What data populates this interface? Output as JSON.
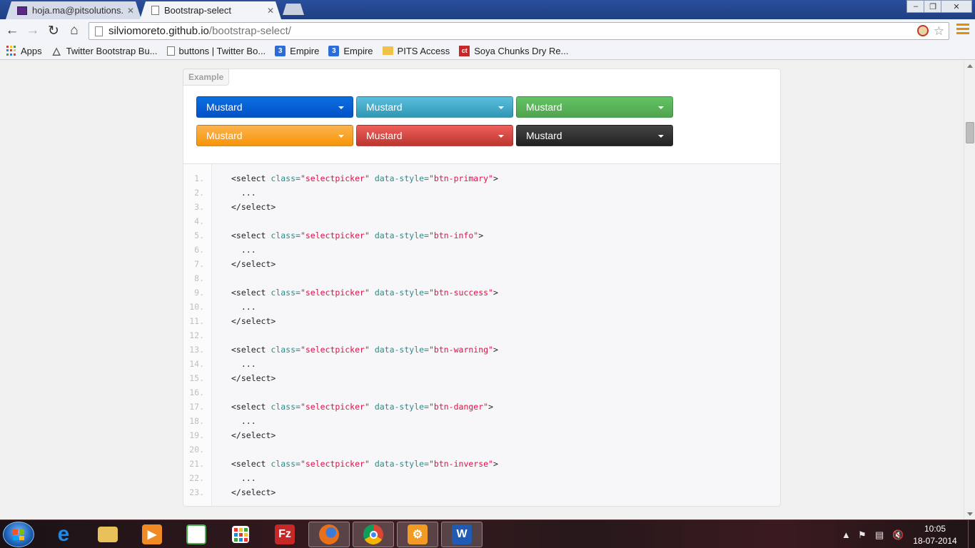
{
  "browser": {
    "tabs": [
      {
        "label": "hoja.ma@pitsolutions.cor",
        "active": false,
        "icon": "mail-icon"
      },
      {
        "label": "Bootstrap-select",
        "active": true,
        "icon": "page-icon"
      }
    ],
    "close_glyph": "✕",
    "url_host": "silviomoreto.github.io",
    "url_path": "/bootstrap-select/",
    "bookmarks": [
      {
        "label": "Apps",
        "icon": "apps-grid-icon"
      },
      {
        "label": "Twitter Bootstrap Bu...",
        "icon": "flask-icon"
      },
      {
        "label": "buttons | Twitter Bo...",
        "icon": "page-icon"
      },
      {
        "label": "Empire",
        "icon": "empire-icon",
        "glyph": "3"
      },
      {
        "label": "Empire",
        "icon": "empire-icon",
        "glyph": "3"
      },
      {
        "label": "PITS Access",
        "icon": "folder-icon"
      },
      {
        "label": "Soya Chunks Dry Re...",
        "icon": "ct-icon",
        "glyph": "ct"
      }
    ]
  },
  "example": {
    "label": "Example",
    "selects": [
      {
        "value": "Mustard",
        "style": "btn-primary"
      },
      {
        "value": "Mustard",
        "style": "btn-info"
      },
      {
        "value": "Mustard",
        "style": "btn-success"
      },
      {
        "value": "Mustard",
        "style": "btn-warning"
      },
      {
        "value": "Mustard",
        "style": "btn-danger"
      },
      {
        "value": "Mustard",
        "style": "btn-inverse"
      }
    ]
  },
  "code": {
    "lines": [
      {
        "n": "1.",
        "kind": "open",
        "style": "btn-primary"
      },
      {
        "n": "2.",
        "kind": "dots"
      },
      {
        "n": "3.",
        "kind": "close"
      },
      {
        "n": "4.",
        "kind": "blank"
      },
      {
        "n": "5.",
        "kind": "open",
        "style": "btn-info"
      },
      {
        "n": "6.",
        "kind": "dots"
      },
      {
        "n": "7.",
        "kind": "close"
      },
      {
        "n": "8.",
        "kind": "blank"
      },
      {
        "n": "9.",
        "kind": "open",
        "style": "btn-success"
      },
      {
        "n": "10.",
        "kind": "dots"
      },
      {
        "n": "11.",
        "kind": "close"
      },
      {
        "n": "12.",
        "kind": "blank"
      },
      {
        "n": "13.",
        "kind": "open",
        "style": "btn-warning"
      },
      {
        "n": "14.",
        "kind": "dots"
      },
      {
        "n": "15.",
        "kind": "close"
      },
      {
        "n": "16.",
        "kind": "blank"
      },
      {
        "n": "17.",
        "kind": "open",
        "style": "btn-danger"
      },
      {
        "n": "18.",
        "kind": "dots"
      },
      {
        "n": "19.",
        "kind": "close"
      },
      {
        "n": "20.",
        "kind": "blank"
      },
      {
        "n": "21.",
        "kind": "open",
        "style": "btn-inverse"
      },
      {
        "n": "22.",
        "kind": "dots"
      },
      {
        "n": "23.",
        "kind": "close"
      }
    ],
    "tokens": {
      "open_tag": "<select",
      "class_attr": "class=",
      "class_val": "\"selectpicker\"",
      "style_attr": "data-style=",
      "gt": ">",
      "dots": "...",
      "close_tag": "</select>"
    }
  },
  "taskbar": {
    "items": [
      {
        "name": "internet-explorer-icon",
        "glyph": "e",
        "color": "#1e88e5"
      },
      {
        "name": "file-explorer-icon",
        "glyph": "",
        "color": "#e8c15a"
      },
      {
        "name": "media-player-icon",
        "glyph": "▶",
        "color": "#f08a24"
      },
      {
        "name": "chart-app-icon",
        "glyph": "",
        "color": "#4caf50"
      },
      {
        "name": "apps-grid-icon",
        "glyph": "",
        "color": "#ffffff"
      },
      {
        "name": "filezilla-icon",
        "glyph": "Fz",
        "color": "#c62828"
      },
      {
        "name": "firefox-icon",
        "glyph": "",
        "color": "#e8701a",
        "active": true
      },
      {
        "name": "chrome-icon",
        "glyph": "",
        "color": "#2e7d32",
        "active": true
      },
      {
        "name": "settings-app-icon",
        "glyph": "⚙",
        "color": "#f29b24",
        "active": true
      },
      {
        "name": "word-icon",
        "glyph": "W",
        "color": "#1f5bb5",
        "active": true
      }
    ],
    "clock_time": "10:05",
    "clock_date": "18-07-2014"
  },
  "colors": {
    "primary": "#0451c9",
    "info": "#2f96b4",
    "success": "#51a351",
    "warning": "#f89406",
    "danger": "#bd362f",
    "inverse": "#222222"
  }
}
